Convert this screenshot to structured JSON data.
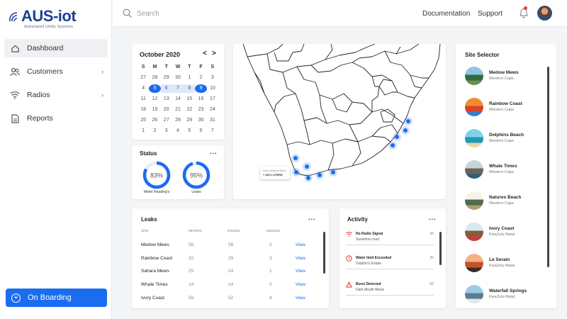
{
  "app": {
    "logo_text": "AUS-iot",
    "logo_tagline": "Automated Utility Systems"
  },
  "sidebar": {
    "items": [
      {
        "label": "Dashboard",
        "icon": "home-icon",
        "active": true
      },
      {
        "label": "Customers",
        "icon": "users-icon",
        "has_submenu": true
      },
      {
        "label": "Radios",
        "icon": "wifi-icon",
        "has_submenu": true
      },
      {
        "label": "Reports",
        "icon": "document-icon"
      }
    ],
    "onboarding_label": "On Boarding"
  },
  "topbar": {
    "search_placeholder": "Search",
    "documentation_label": "Documentation",
    "support_label": "Support"
  },
  "calendar": {
    "title": "October 2020",
    "prev": "<",
    "next": ">",
    "weekdays": [
      "S",
      "M",
      "T",
      "W",
      "T",
      "F",
      "S"
    ],
    "days": [
      "27",
      "28",
      "29",
      "30",
      "1",
      "2",
      "3",
      "4",
      "5",
      "6",
      "7",
      "8",
      "9",
      "10",
      "11",
      "12",
      "13",
      "14",
      "15",
      "16",
      "17",
      "18",
      "19",
      "20",
      "21",
      "22",
      "23",
      "24",
      "25",
      "26",
      "27",
      "28",
      "29",
      "30",
      "31",
      "1",
      "2",
      "3",
      "4",
      "5",
      "6",
      "7"
    ],
    "range_start": "5",
    "range_end": "9"
  },
  "status": {
    "title": "Status",
    "more": "...",
    "gauges": [
      {
        "value": "83%",
        "percent": 83,
        "label": "Meter Reading's"
      },
      {
        "value": "95%",
        "percent": 95,
        "label": "Leaks"
      }
    ]
  },
  "map": {
    "tooltip_line1": "Dwelt Moisture Meter",
    "tooltip_line2": "+ 2671 LITERS"
  },
  "leaks": {
    "title": "Leaks",
    "more": "...",
    "columns": [
      "SITE",
      "METERS",
      "RADIOS",
      "MISSING"
    ],
    "rows": [
      {
        "site": "Medow Mews",
        "meters": "56",
        "radios": "56",
        "missing": "0",
        "action": "View"
      },
      {
        "site": "Rainbow Coast",
        "meters": "32",
        "radios": "29",
        "missing": "3",
        "action": "View"
      },
      {
        "site": "Sahara Mews",
        "meters": "25",
        "radios": "24",
        "missing": "1",
        "action": "View"
      },
      {
        "site": "Whale Times",
        "meters": "14",
        "radios": "14",
        "missing": "0",
        "action": "View"
      },
      {
        "site": "Ivory Coast",
        "meters": "56",
        "radios": "52",
        "missing": "4",
        "action": "View"
      }
    ]
  },
  "activity": {
    "title": "Activity",
    "more": "...",
    "items": [
      {
        "title": "No Radio Signal",
        "subtitle": "Sunshine court",
        "time": "1h",
        "icon": "no-signal-icon",
        "color": "#e63939"
      },
      {
        "title": "Water limit Exceeded",
        "subtitle": "Dolphin's Estate",
        "time": "2h",
        "icon": "alert-circle-icon",
        "color": "#e63939"
      },
      {
        "title": "Burst Detected",
        "subtitle": "Dark Mouth Mews",
        "time": "1D",
        "icon": "warning-triangle-icon",
        "color": "#e63939"
      }
    ]
  },
  "sites": {
    "title": "Site Selector",
    "items": [
      {
        "name": "Medow Mews",
        "region": "Western Cape",
        "palette": [
          "#8fc3e8",
          "#2f6e3a",
          "#6b8f4a"
        ]
      },
      {
        "name": "Rainbow Coast",
        "region": "Western Cape",
        "palette": [
          "#f28a2e",
          "#d8432c",
          "#3a7bd5"
        ]
      },
      {
        "name": "Dolphins Beach",
        "region": "Western Cape",
        "palette": [
          "#7fd3e6",
          "#1e9bb5",
          "#e8d7a8"
        ]
      },
      {
        "name": "Whale Times",
        "region": "Western Cape",
        "palette": [
          "#c9d4da",
          "#6b6459",
          "#2d5e7a"
        ]
      },
      {
        "name": "Natures Beach",
        "region": "Western Cape",
        "palette": [
          "#f6f3ea",
          "#4f6b52",
          "#b59a6c"
        ]
      },
      {
        "name": "Ivory Coast",
        "region": "KwaZulu-Natal",
        "palette": [
          "#d6e8f0",
          "#8a5b3a",
          "#c93b3b"
        ]
      },
      {
        "name": "Le Serain",
        "region": "KwaZulu-Natal",
        "palette": [
          "#f4b183",
          "#c0542f",
          "#3b2a22"
        ]
      },
      {
        "name": "Waterfall Springs",
        "region": "KwaZulu-Natal",
        "palette": [
          "#9ccbe6",
          "#5c7c8f",
          "#dfe9ef"
        ]
      }
    ]
  },
  "colors": {
    "accent": "#1a6df0",
    "brand": "#1f3f91",
    "alert": "#e63939"
  }
}
